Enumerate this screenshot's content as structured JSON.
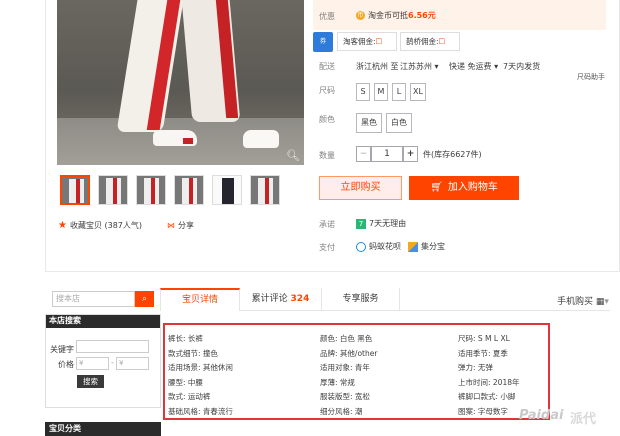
{
  "top": {
    "youhui_label": "优惠",
    "coin_text": "淘金币可抵",
    "coin_amount": "6.56元",
    "commission_left": "淘客佣金:",
    "commission_right": "鹊桥佣金:",
    "ship_label": "配送",
    "ship_from": "浙江杭州 至",
    "ship_to": "江苏苏州",
    "ship_fee": "快递 免运费",
    "ship_time": "7天内发货",
    "size_help": "尺码助手",
    "size_label": "尺码",
    "sizes": [
      "S",
      "M",
      "L",
      "XL"
    ],
    "color_label": "颜色",
    "colors": [
      "黑色",
      "白色"
    ],
    "qty_label": "数量",
    "qty_minus": "−",
    "qty_value": "1",
    "qty_plus": "+",
    "qty_stock": "件(库存6627件)",
    "buy_now": "立即购买",
    "add_cart": "加入购物车",
    "promise_label": "承诺",
    "promise_text": "7天无理由",
    "pay_label": "支付",
    "pay_huabei": "蚂蚁花呗",
    "pay_jifen": "集分宝",
    "fav_text": "收藏宝贝 (387人气)",
    "share_text": "分享"
  },
  "sidebar": {
    "search_placeholder": "搜本店",
    "shop_search_title": "本店搜索",
    "keyword_label": "关键字",
    "price_label": "价格",
    "price_from_placeholder": "¥",
    "price_to_placeholder": "¥",
    "search_button": "搜索",
    "category_title": "宝贝分类"
  },
  "tabs": {
    "detail": "宝贝详情",
    "reviews": "累计评论",
    "reviews_count": "324",
    "service": "专享服务",
    "mobile_buy": "手机购买"
  },
  "attributes": [
    [
      "裤长: 长裤",
      "颜色: 白色 黑色",
      "尺码: S M L XL"
    ],
    [
      "款式细节: 撞色",
      "品牌: 其他/other",
      "适用季节: 夏季"
    ],
    [
      "适用场景: 其他休闲",
      "适用对象: 青年",
      "弹力: 无弹"
    ],
    [
      "腰型: 中腰",
      "厚薄: 常规",
      "上市时间: 2018年"
    ],
    [
      "款式: 运动裤",
      "服装版型: 宽松",
      "裤脚口款式: 小脚"
    ],
    [
      "基础风格: 青春流行",
      "细分风格: 潮",
      "图案: 字母数字"
    ]
  ],
  "watermark": "Paidai",
  "watermark_cn": "派代",
  "colors": {
    "accent": "#ff4400",
    "highlight_box": "#e0363b",
    "dark_header": "#2b2b2b"
  }
}
